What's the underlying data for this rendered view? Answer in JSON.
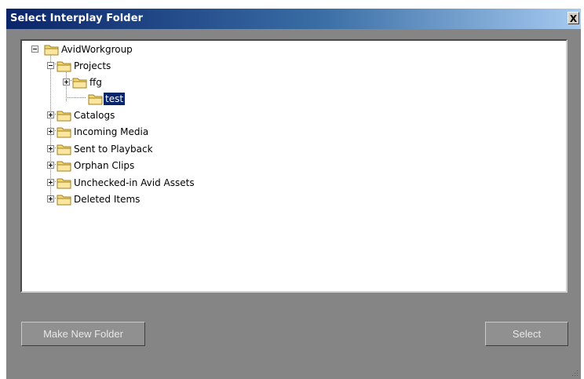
{
  "dialog": {
    "title": "Select Interplay Folder",
    "close_label": "X"
  },
  "tree": {
    "root": "AvidWorkgroup",
    "projects": "Projects",
    "ffg": "ffg",
    "test": "test",
    "catalogs": "Catalogs",
    "incoming_media": "Incoming Media",
    "sent_to_playback": "Sent to Playback",
    "orphan_clips": "Orphan Clips",
    "unchecked_in": "Unchecked-in Avid Assets",
    "deleted_items": "Deleted Items",
    "selected_item": "test"
  },
  "buttons": {
    "make_new_folder": "Make New Folder",
    "select": "Select"
  },
  "colors": {
    "title_start": "#0a246a",
    "title_end": "#a6caf0",
    "selection": "#0a246a",
    "panel_bg": "#858585",
    "folder": "#f5d772"
  }
}
